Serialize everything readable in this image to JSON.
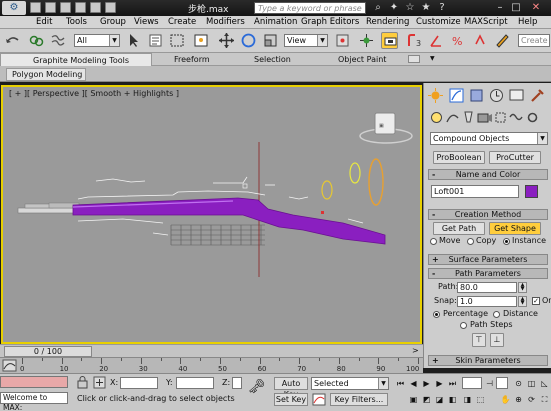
{
  "titlebar": {
    "title": "步枪.max",
    "search_placeholder": "Type a keyword or phrase"
  },
  "menu": [
    "Edit",
    "Tools",
    "Group",
    "Views",
    "Create",
    "Modifiers",
    "Animation",
    "Graph Editors",
    "Rendering",
    "Customize",
    "MAXScript",
    "Help"
  ],
  "toolbar": {
    "filter_value": "All",
    "refcoord_value": "View",
    "create_selection_placeholder": "Create"
  },
  "ribbon": {
    "tabs": [
      "Graphite Modeling Tools",
      "Freeform",
      "Selection",
      "Object Paint"
    ],
    "active_panel": "Polygon Modeling"
  },
  "viewport": {
    "label": "[ + ][ Perspective ][ Smooth + Highlights ]"
  },
  "command_panel": {
    "category": "Compound Objects",
    "buttons": [
      "ProBoolean",
      "ProCutter"
    ],
    "name_color_title": "Name and Color",
    "object_name": "Loft001",
    "object_color": "#8a1fc0",
    "creation_method_title": "Creation Method",
    "get_path": "Get Path",
    "get_shape": "Get Shape",
    "move": "Move",
    "copy": "Copy",
    "instance": "Instance",
    "surface_params_title": "Surface Parameters",
    "path_params_title": "Path Parameters",
    "path_label": "Path:",
    "path_value": "80.0",
    "snap_label": "Snap:",
    "snap_value": "1.0",
    "on_label": "On",
    "percentage": "Percentage",
    "distance": "Distance",
    "path_steps": "Path Steps",
    "skin_params_title": "Skin Parameters"
  },
  "timeline": {
    "slider_label": "0 / 100",
    "ticks": [
      "0",
      "10",
      "20",
      "30",
      "40",
      "50",
      "60",
      "70",
      "80",
      "90",
      "100"
    ]
  },
  "status": {
    "welcome": "Welcome to MAX:",
    "prompt": "Click or click-and-drag to select objects",
    "x_label": "X:",
    "y_label": "Y:",
    "z_label": "Z:",
    "auto_key": "Auto Key",
    "set_key": "Set Key",
    "selected": "Selected",
    "key_filters": "Key Filters..."
  },
  "colors": {
    "gun_stock": "#8a1fc0",
    "viewport_border": "#e8d000",
    "active_button": "#ffcd3c"
  }
}
